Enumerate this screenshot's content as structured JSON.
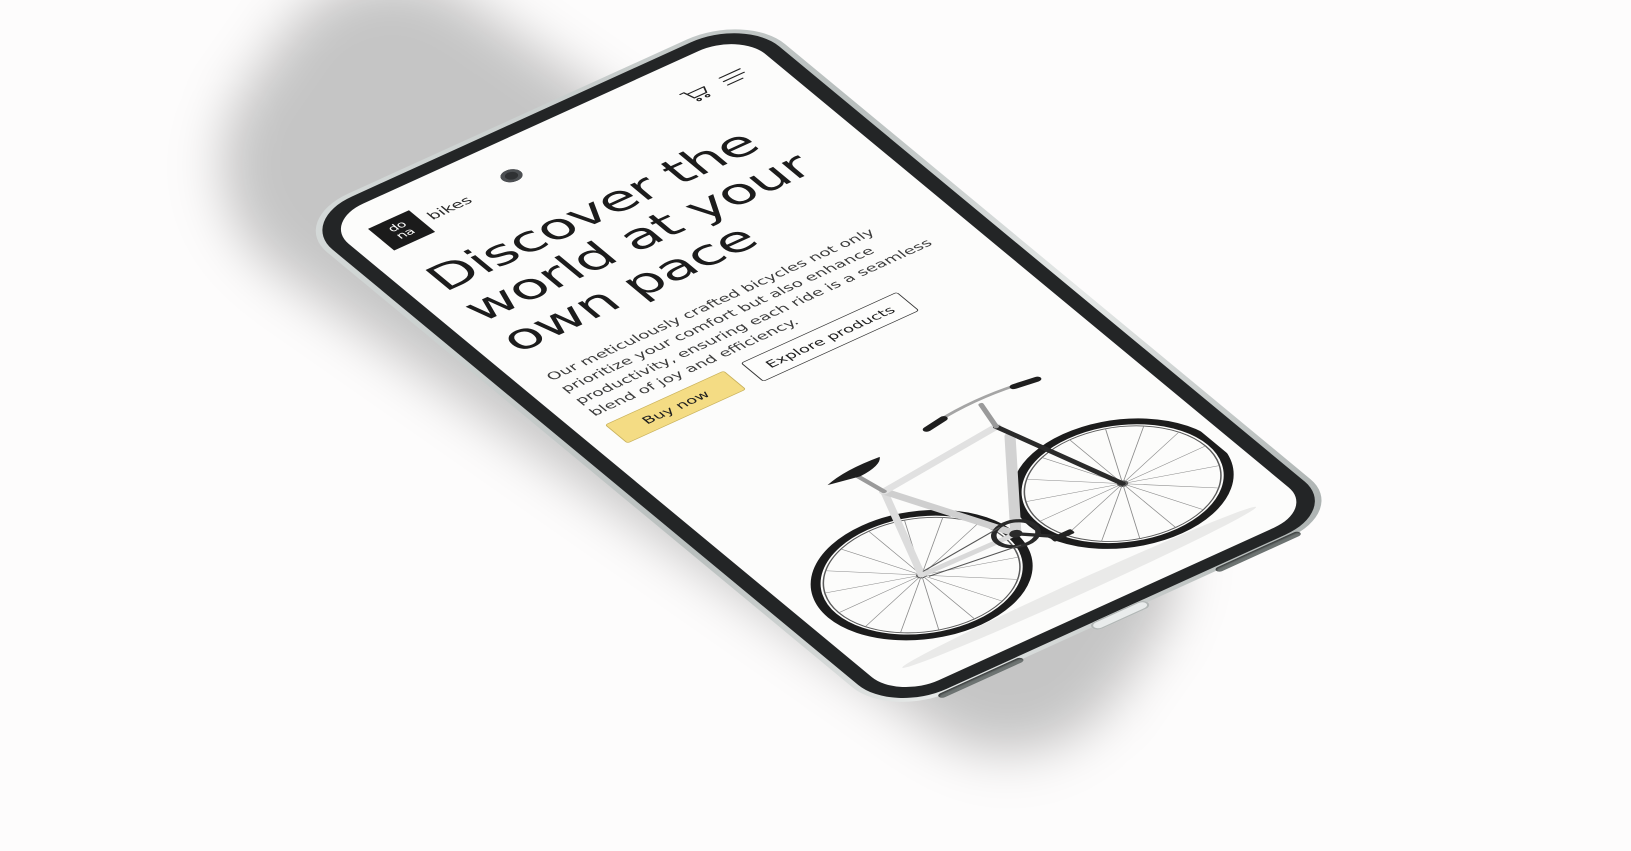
{
  "brand": {
    "logo_line1": "do",
    "logo_line2": "na",
    "wordmark": "bikes"
  },
  "header": {
    "cart_icon": "cart-icon",
    "menu_icon": "hamburger-menu-icon"
  },
  "hero": {
    "headline_lines": [
      "Discover the",
      "world at your",
      "own pace"
    ],
    "description_lines": [
      "Our meticulously crafted bicycles not only",
      "prioritize your comfort but also enhance",
      "productivity, ensuring each ride is a seamless",
      "blend of joy and efficiency."
    ],
    "buy_label": "Buy now",
    "explore_label": "Explore products",
    "image": "bicycle"
  },
  "colors": {
    "accent": "#f4dc84",
    "text": "#1c1c1c",
    "screen_bg": "#fcfcfb",
    "bezel": "#232526"
  }
}
